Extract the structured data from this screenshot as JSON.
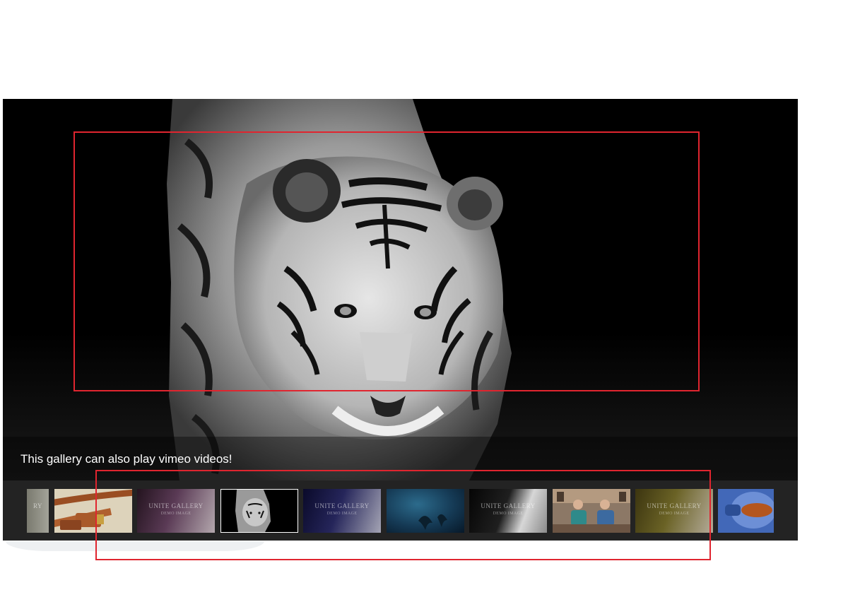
{
  "gallery": {
    "caption": "This gallery can also play vimeo videos!",
    "thumbnails": [
      {
        "name": "thumb-partial-demo",
        "demo_title": "RY",
        "demo_sub": "",
        "selected": false
      },
      {
        "name": "thumb-copper-cable",
        "demo_title": "",
        "demo_sub": "",
        "selected": false
      },
      {
        "name": "thumb-demo-purple",
        "demo_title": "UNITE GALLERY",
        "demo_sub": "DEMO IMAGE",
        "selected": false
      },
      {
        "name": "thumb-tiger",
        "demo_title": "",
        "demo_sub": "",
        "selected": true
      },
      {
        "name": "thumb-demo-navy",
        "demo_title": "UNITE GALLERY",
        "demo_sub": "DEMO IMAGE",
        "selected": false
      },
      {
        "name": "thumb-underwater",
        "demo_title": "",
        "demo_sub": "",
        "selected": false
      },
      {
        "name": "thumb-demo-black",
        "demo_title": "UNITE GALLERY",
        "demo_sub": "DEMO IMAGE",
        "selected": false
      },
      {
        "name": "thumb-video-people",
        "demo_title": "",
        "demo_sub": "",
        "selected": false
      },
      {
        "name": "thumb-demo-olive",
        "demo_title": "UNITE GALLERY",
        "demo_sub": "DEMO IMAGE",
        "selected": false
      },
      {
        "name": "thumb-blue-sunglasses",
        "demo_title": "",
        "demo_sub": "",
        "selected": false
      }
    ]
  },
  "colors": {
    "annotation_red": "#e0252f",
    "strip_background": "#232323",
    "selected_border": "#ffffff"
  }
}
